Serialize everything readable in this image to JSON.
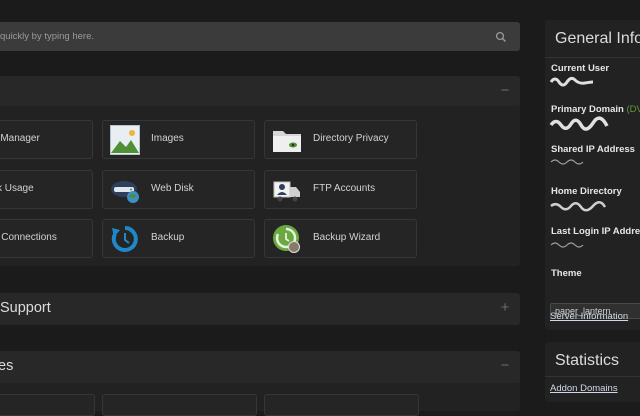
{
  "search": {
    "placeholder": "quickly by typing here."
  },
  "files_section": {
    "collapse_glyph": "−",
    "tiles": [
      {
        "label": "e Manager",
        "icon": "file-manager-icon"
      },
      {
        "label": "Images",
        "icon": "images-icon"
      },
      {
        "label": "Directory Privacy",
        "icon": "directory-privacy-icon"
      },
      {
        "label": "sk Usage",
        "icon": "disk-usage-icon"
      },
      {
        "label": "Web Disk",
        "icon": "web-disk-icon"
      },
      {
        "label": "FTP Accounts",
        "icon": "ftp-accounts-icon"
      },
      {
        "label": "P Connections",
        "icon": "ftp-connections-icon"
      },
      {
        "label": "Backup",
        "icon": "backup-icon"
      },
      {
        "label": "Backup Wizard",
        "icon": "backup-wizard-icon"
      }
    ]
  },
  "support_section": {
    "title": "Support",
    "expand_glyph": "+"
  },
  "third_section": {
    "title": "es",
    "collapse_glyph": "−"
  },
  "general_info": {
    "title": "General Infor",
    "current_user_label": "Current User",
    "primary_domain_label": "Primary Domain",
    "primary_domain_link": "(DV",
    "shared_ip_label": "Shared IP Address",
    "home_directory_label": "Home Directory",
    "last_login_label": "Last Login IP Addres",
    "theme_label": "Theme",
    "theme_value": "paper_lantern",
    "server_info_link": "Server Information"
  },
  "statistics": {
    "title": "Statistics",
    "addon_domains_link": "Addon Domains"
  },
  "colors": {
    "background": "#1b1b1b",
    "panel": "#222222",
    "tile": "#252525",
    "accent_green": "#5c9a3c",
    "backup_blue": "#1e88c8"
  }
}
